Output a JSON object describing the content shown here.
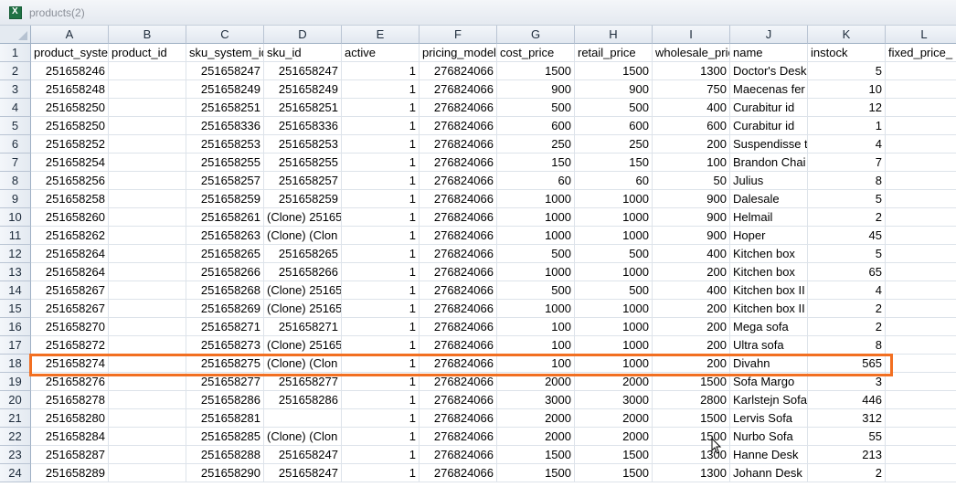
{
  "window": {
    "title": "products(2)"
  },
  "columns": [
    {
      "letter": "A",
      "header": "product_system_id"
    },
    {
      "letter": "B",
      "header": "product_id"
    },
    {
      "letter": "C",
      "header": "sku_system_id"
    },
    {
      "letter": "D",
      "header": "sku_id"
    },
    {
      "letter": "E",
      "header": "active"
    },
    {
      "letter": "F",
      "header": "pricing_model"
    },
    {
      "letter": "G",
      "header": "cost_price"
    },
    {
      "letter": "H",
      "header": "retail_price"
    },
    {
      "letter": "I",
      "header": "wholesale_price"
    },
    {
      "letter": "J",
      "header": "name"
    },
    {
      "letter": "K",
      "header": "instock"
    },
    {
      "letter": "L",
      "header": "fixed_price_"
    }
  ],
  "rows": [
    {
      "n": "2",
      "A": "251658246",
      "B": "",
      "C": "251658247",
      "D": "251658247",
      "E": "1",
      "F": "276824066",
      "G": "1500",
      "H": "1500",
      "I": "1300",
      "J": "Doctor's Desk",
      "K": "5",
      "L": ""
    },
    {
      "n": "3",
      "A": "251658248",
      "B": "",
      "C": "251658249",
      "D": "251658249",
      "E": "1",
      "F": "276824066",
      "G": "900",
      "H": "900",
      "I": "750",
      "J": "Maecenas fer",
      "K": "10",
      "L": ""
    },
    {
      "n": "4",
      "A": "251658250",
      "B": "",
      "C": "251658251",
      "D": "251658251",
      "E": "1",
      "F": "276824066",
      "G": "500",
      "H": "500",
      "I": "400",
      "J": "Curabitur id",
      "K": "12",
      "L": ""
    },
    {
      "n": "5",
      "A": "251658250",
      "B": "",
      "C": "251658336",
      "D": "251658336",
      "E": "1",
      "F": "276824066",
      "G": "600",
      "H": "600",
      "I": "600",
      "J": "Curabitur id",
      "K": "1",
      "L": ""
    },
    {
      "n": "6",
      "A": "251658252",
      "B": "",
      "C": "251658253",
      "D": "251658253",
      "E": "1",
      "F": "276824066",
      "G": "250",
      "H": "250",
      "I": "200",
      "J": "Suspendisse t",
      "K": "4",
      "L": ""
    },
    {
      "n": "7",
      "A": "251658254",
      "B": "",
      "C": "251658255",
      "D": "251658255",
      "E": "1",
      "F": "276824066",
      "G": "150",
      "H": "150",
      "I": "100",
      "J": "Brandon Chai",
      "K": "7",
      "L": ""
    },
    {
      "n": "8",
      "A": "251658256",
      "B": "",
      "C": "251658257",
      "D": "251658257",
      "E": "1",
      "F": "276824066",
      "G": "60",
      "H": "60",
      "I": "50",
      "J": "Julius",
      "K": "8",
      "L": ""
    },
    {
      "n": "9",
      "A": "251658258",
      "B": "",
      "C": "251658259",
      "D": "251658259",
      "E": "1",
      "F": "276824066",
      "G": "1000",
      "H": "1000",
      "I": "900",
      "J": "Dalesale",
      "K": "5",
      "L": ""
    },
    {
      "n": "10",
      "A": "251658260",
      "B": "",
      "C": "251658261",
      "D": "(Clone) 25165",
      "E": "1",
      "F": "276824066",
      "G": "1000",
      "H": "1000",
      "I": "900",
      "J": "Helmail",
      "K": "2",
      "L": ""
    },
    {
      "n": "11",
      "A": "251658262",
      "B": "",
      "C": "251658263",
      "D": "(Clone) (Clon",
      "E": "1",
      "F": "276824066",
      "G": "1000",
      "H": "1000",
      "I": "900",
      "J": "Hoper",
      "K": "45",
      "L": ""
    },
    {
      "n": "12",
      "A": "251658264",
      "B": "",
      "C": "251658265",
      "D": "251658265",
      "E": "1",
      "F": "276824066",
      "G": "500",
      "H": "500",
      "I": "400",
      "J": "Kitchen box",
      "K": "5",
      "L": ""
    },
    {
      "n": "13",
      "A": "251658264",
      "B": "",
      "C": "251658266",
      "D": "251658266",
      "E": "1",
      "F": "276824066",
      "G": "1000",
      "H": "1000",
      "I": "200",
      "J": "Kitchen box",
      "K": "65",
      "L": ""
    },
    {
      "n": "14",
      "A": "251658267",
      "B": "",
      "C": "251658268",
      "D": "(Clone) 25165",
      "E": "1",
      "F": "276824066",
      "G": "500",
      "H": "500",
      "I": "400",
      "J": "Kitchen box II",
      "K": "4",
      "L": ""
    },
    {
      "n": "15",
      "A": "251658267",
      "B": "",
      "C": "251658269",
      "D": "(Clone) 25165",
      "E": "1",
      "F": "276824066",
      "G": "1000",
      "H": "1000",
      "I": "200",
      "J": "Kitchen box II",
      "K": "2",
      "L": ""
    },
    {
      "n": "16",
      "A": "251658270",
      "B": "",
      "C": "251658271",
      "D": "251658271",
      "E": "1",
      "F": "276824066",
      "G": "100",
      "H": "1000",
      "I": "200",
      "J": "Mega sofa",
      "K": "2",
      "L": ""
    },
    {
      "n": "17",
      "A": "251658272",
      "B": "",
      "C": "251658273",
      "D": "(Clone) 25165",
      "E": "1",
      "F": "276824066",
      "G": "100",
      "H": "1000",
      "I": "200",
      "J": "Ultra sofa",
      "K": "8",
      "L": ""
    },
    {
      "n": "18",
      "A": "251658274",
      "B": "",
      "C": "251658275",
      "D": "(Clone) (Clon",
      "E": "1",
      "F": "276824066",
      "G": "100",
      "H": "1000",
      "I": "200",
      "J": "Divahn",
      "K": "565",
      "L": ""
    },
    {
      "n": "19",
      "A": "251658276",
      "B": "",
      "C": "251658277",
      "D": "251658277",
      "E": "1",
      "F": "276824066",
      "G": "2000",
      "H": "2000",
      "I": "1500",
      "J": "Sofa Margo",
      "K": "3",
      "L": ""
    },
    {
      "n": "20",
      "A": "251658278",
      "B": "",
      "C": "251658286",
      "D": "251658286",
      "E": "1",
      "F": "276824066",
      "G": "3000",
      "H": "3000",
      "I": "2800",
      "J": "Karlstejn Sofa",
      "K": "446",
      "L": ""
    },
    {
      "n": "21",
      "A": "251658280",
      "B": "",
      "C": "251658281",
      "D": "",
      "E": "1",
      "F": "276824066",
      "G": "2000",
      "H": "2000",
      "I": "1500",
      "J": "Lervis Sofa",
      "K": "312",
      "L": ""
    },
    {
      "n": "22",
      "A": "251658284",
      "B": "",
      "C": "251658285",
      "D": "(Clone) (Clon",
      "E": "1",
      "F": "276824066",
      "G": "2000",
      "H": "2000",
      "I": "1500",
      "J": "Nurbo Sofa",
      "K": "55",
      "L": ""
    },
    {
      "n": "23",
      "A": "251658287",
      "B": "",
      "C": "251658288",
      "D": "251658247",
      "E": "1",
      "F": "276824066",
      "G": "1500",
      "H": "1500",
      "I": "1300",
      "J": "Hanne Desk",
      "K": "213",
      "L": ""
    },
    {
      "n": "24",
      "A": "251658289",
      "B": "",
      "C": "251658290",
      "D": "251658247",
      "E": "1",
      "F": "276824066",
      "G": "1500",
      "H": "1500",
      "I": "1300",
      "J": "Johann Desk",
      "K": "2",
      "L": ""
    }
  ],
  "highlighted_row": "18",
  "colors": {
    "highlight_border": "#f26f21",
    "header_bg": "#e2e8f0",
    "gridline": "#dde3ea"
  }
}
